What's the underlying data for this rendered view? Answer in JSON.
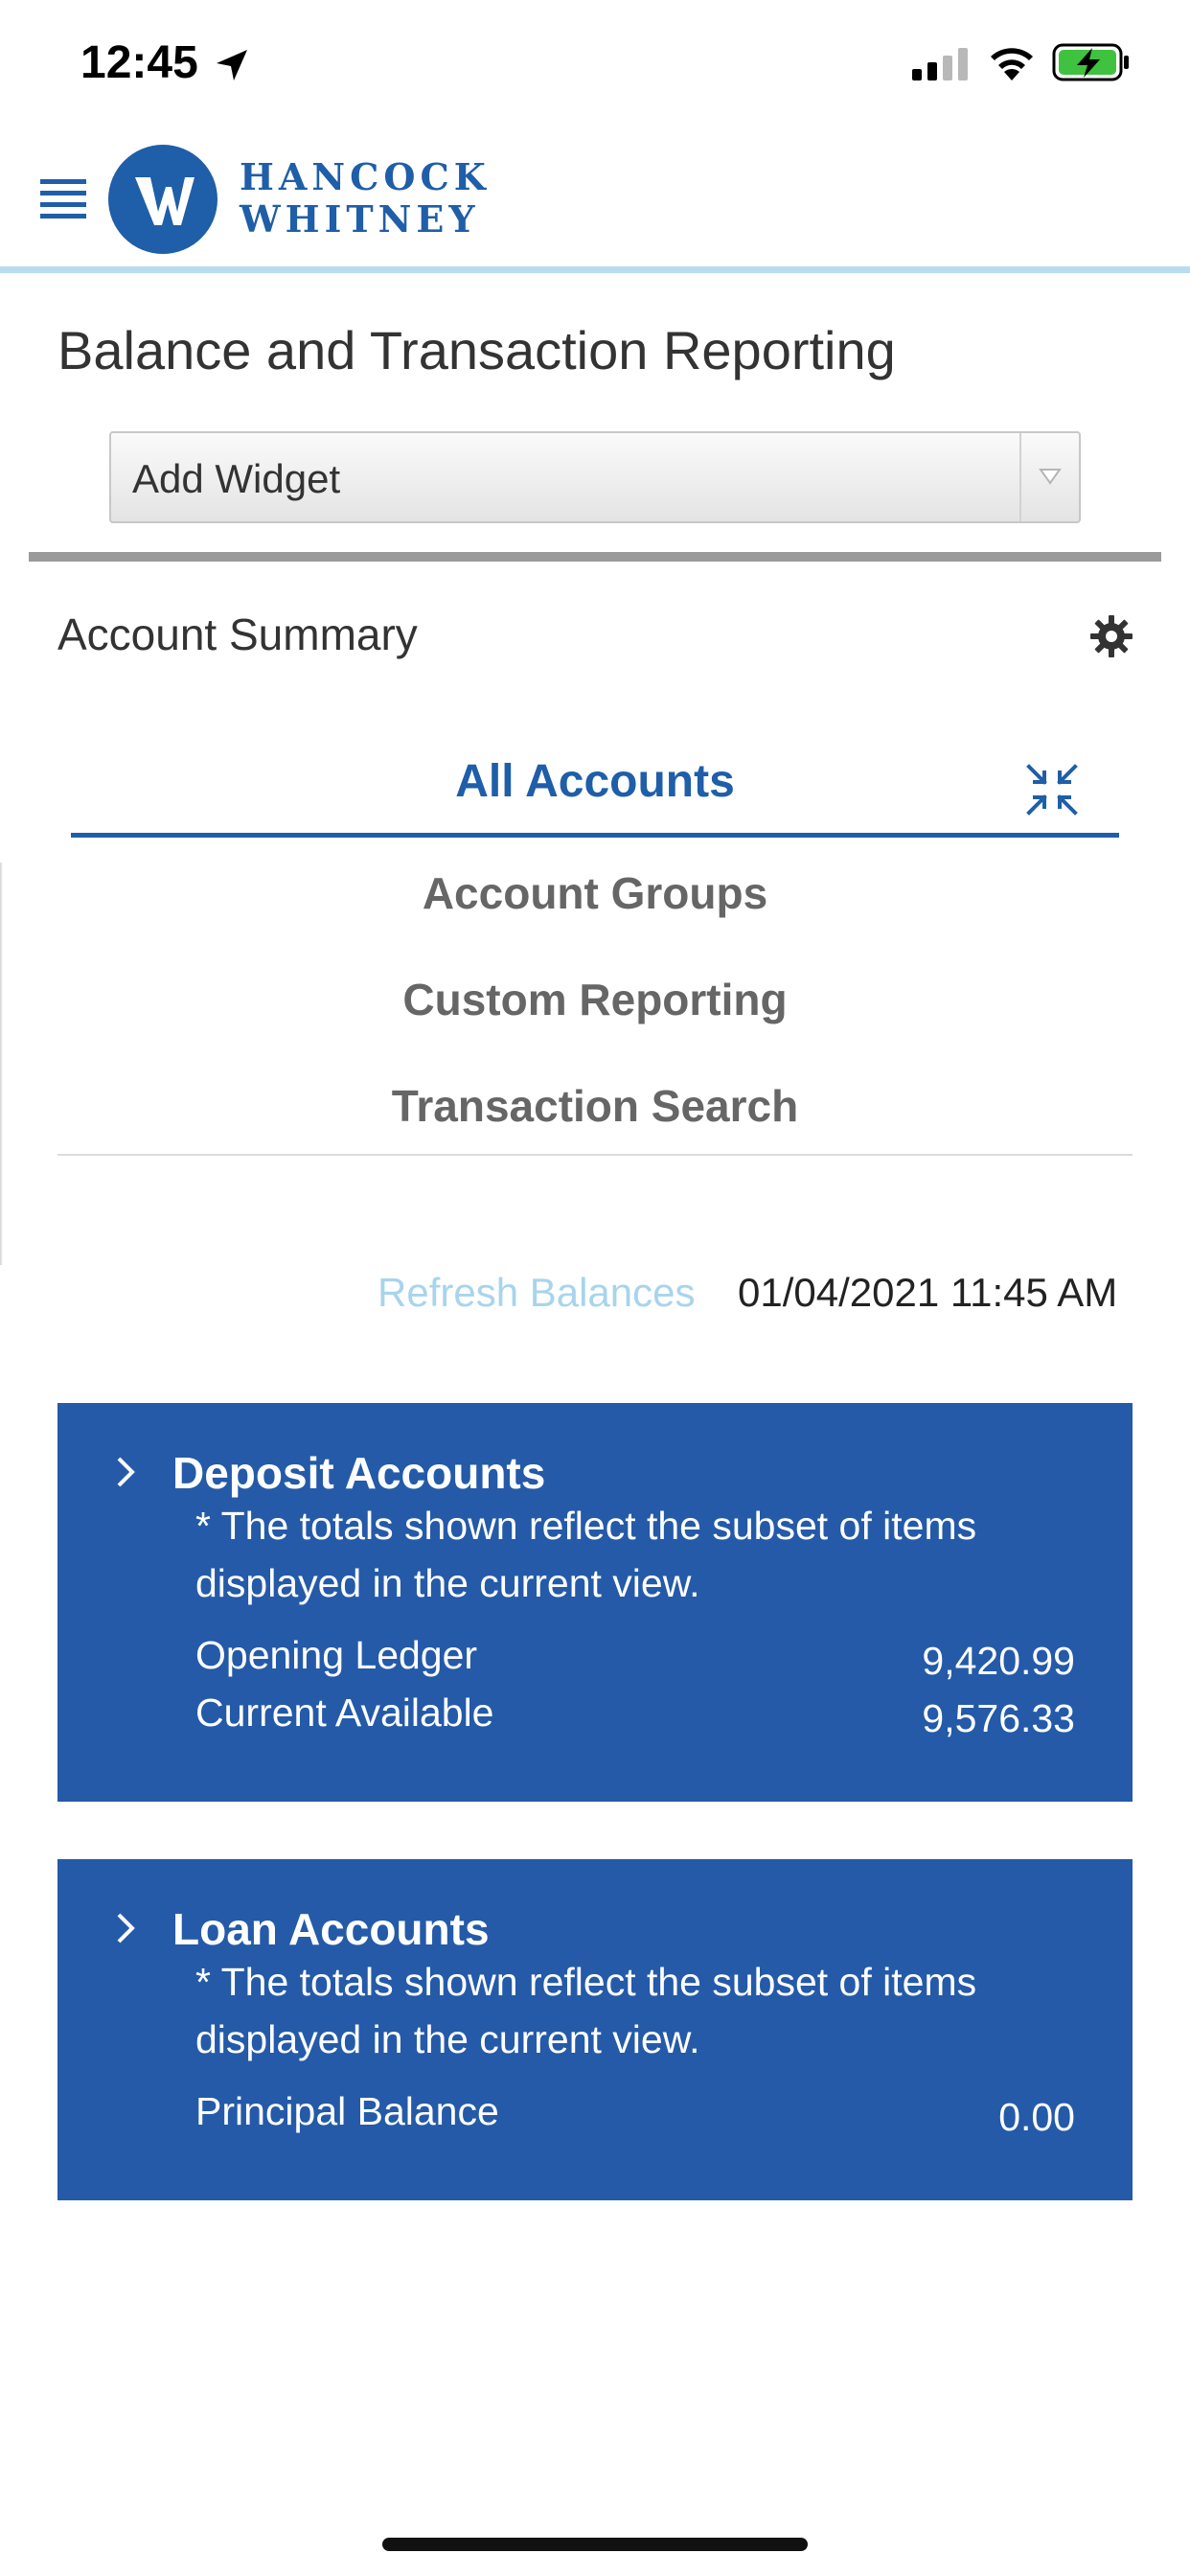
{
  "status_bar": {
    "time": "12:45"
  },
  "header": {
    "logo_line1": "HANCOCK",
    "logo_line2": "WHITNEY",
    "logo_letter": "W"
  },
  "page": {
    "title": "Balance and Transaction Reporting"
  },
  "widget_select": {
    "selected": "Add Widget"
  },
  "account_summary": {
    "title": "Account Summary",
    "tabs": [
      {
        "label": "All Accounts",
        "active": true
      },
      {
        "label": "Account Groups",
        "active": false
      },
      {
        "label": "Custom Reporting",
        "active": false
      },
      {
        "label": "Transaction Search",
        "active": false
      }
    ],
    "refresh_label": "Refresh Balances",
    "refresh_time": "01/04/2021 11:45 AM"
  },
  "deposit_card": {
    "title": "Deposit Accounts",
    "note": "* The totals shown reflect the subset of items displayed in the current view.",
    "rows": [
      {
        "label": "Opening Ledger",
        "value": "9,420.99"
      },
      {
        "label": "Current Available",
        "value": "9,576.33"
      }
    ]
  },
  "loan_card": {
    "title": "Loan Accounts",
    "note": "* The totals shown reflect the subset of items displayed in the current view.",
    "rows": [
      {
        "label": "Principal Balance",
        "value": "0.00"
      }
    ]
  },
  "colors": {
    "brand_blue": "#1f5ea8",
    "card_blue": "#245aa8",
    "header_rule": "#b9dcef",
    "refresh_link": "#a8d4ec"
  }
}
